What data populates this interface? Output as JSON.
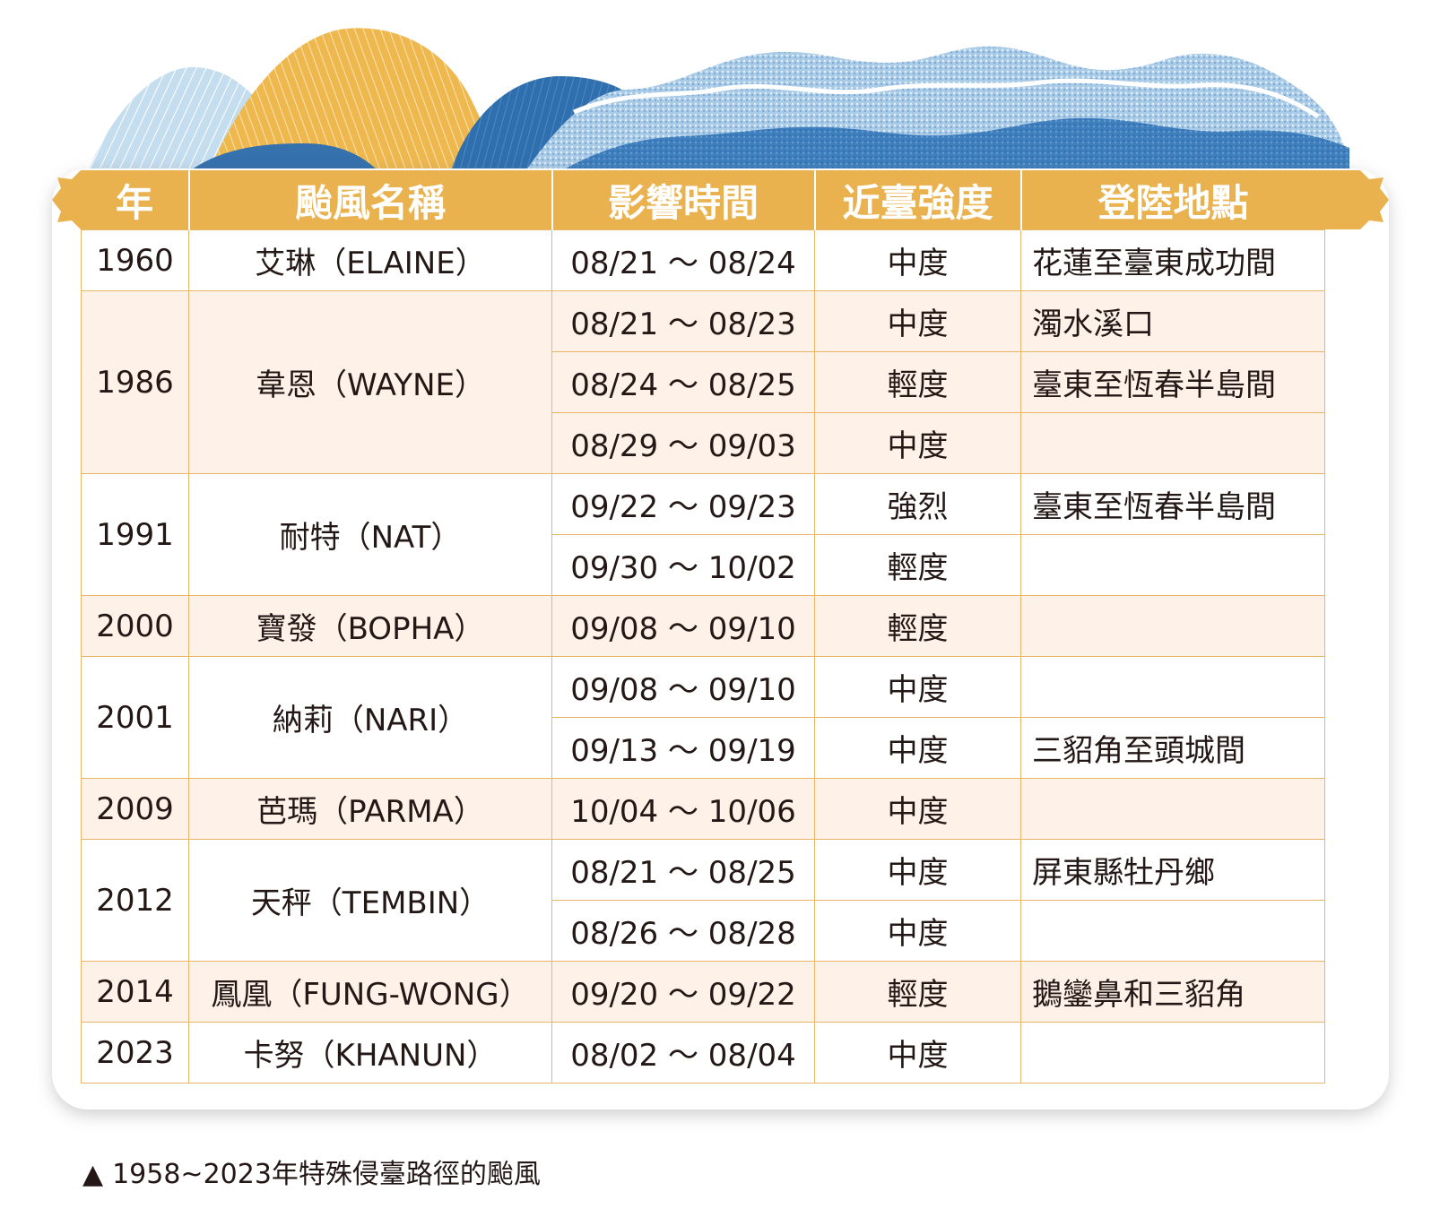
{
  "table": {
    "headers": [
      "年",
      "颱風名稱",
      "影響時間",
      "近臺強度",
      "登陸地點"
    ],
    "groups": [
      {
        "year": "1960",
        "name": "艾琳（ELAINE）",
        "rows": [
          {
            "time": "08/21 ～ 08/24",
            "strength": "中度",
            "landfall": "花蓮至臺東成功間"
          }
        ]
      },
      {
        "year": "1986",
        "name": "韋恩（WAYNE）",
        "rows": [
          {
            "time": "08/21 ～ 08/23",
            "strength": "中度",
            "landfall": "濁水溪口"
          },
          {
            "time": "08/24 ～ 08/25",
            "strength": "輕度",
            "landfall": "臺東至恆春半島間"
          },
          {
            "time": "08/29 ～ 09/03",
            "strength": "中度",
            "landfall": ""
          }
        ]
      },
      {
        "year": "1991",
        "name": "耐特（NAT）",
        "rows": [
          {
            "time": "09/22 ～ 09/23",
            "strength": "強烈",
            "landfall": "臺東至恆春半島間"
          },
          {
            "time": "09/30 ～ 10/02",
            "strength": "輕度",
            "landfall": ""
          }
        ]
      },
      {
        "year": "2000",
        "name": "寶發（BOPHA）",
        "rows": [
          {
            "time": "09/08 ～ 09/10",
            "strength": "輕度",
            "landfall": ""
          }
        ]
      },
      {
        "year": "2001",
        "name": "納莉（NARI）",
        "rows": [
          {
            "time": "09/08 ～ 09/10",
            "strength": "中度",
            "landfall": ""
          },
          {
            "time": "09/13 ～ 09/19",
            "strength": "中度",
            "landfall": "三貂角至頭城間"
          }
        ]
      },
      {
        "year": "2009",
        "name": "芭瑪（PARMA）",
        "rows": [
          {
            "time": "10/04 ～ 10/06",
            "strength": "中度",
            "landfall": ""
          }
        ]
      },
      {
        "year": "2012",
        "name": "天秤（TEMBIN）",
        "rows": [
          {
            "time": "08/21 ～ 08/25",
            "strength": "中度",
            "landfall": "屏東縣牡丹鄉"
          },
          {
            "time": "08/26 ～ 08/28",
            "strength": "中度",
            "landfall": ""
          }
        ]
      },
      {
        "year": "2014",
        "name": "鳳凰（FUNG-WONG）",
        "rows": [
          {
            "time": "09/20 ～ 09/22",
            "strength": "輕度",
            "landfall": "鵝鑾鼻和三貂角"
          }
        ]
      },
      {
        "year": "2023",
        "name": "卡努（KHANUN）",
        "rows": [
          {
            "time": "08/02 ～ 08/04",
            "strength": "中度",
            "landfall": ""
          }
        ]
      }
    ]
  },
  "caption": {
    "marker": "▲",
    "text": "1958~2023年特殊侵臺路徑的颱風"
  },
  "colors": {
    "header_bg": "#e9b24f",
    "border": "#e9b566",
    "shaded_row": "#fdf1e8",
    "text": "#231815",
    "mountain_gold": "#efb84f",
    "mountain_light_blue": "#b8d6ea",
    "mountain_blue": "#2f6fae"
  }
}
